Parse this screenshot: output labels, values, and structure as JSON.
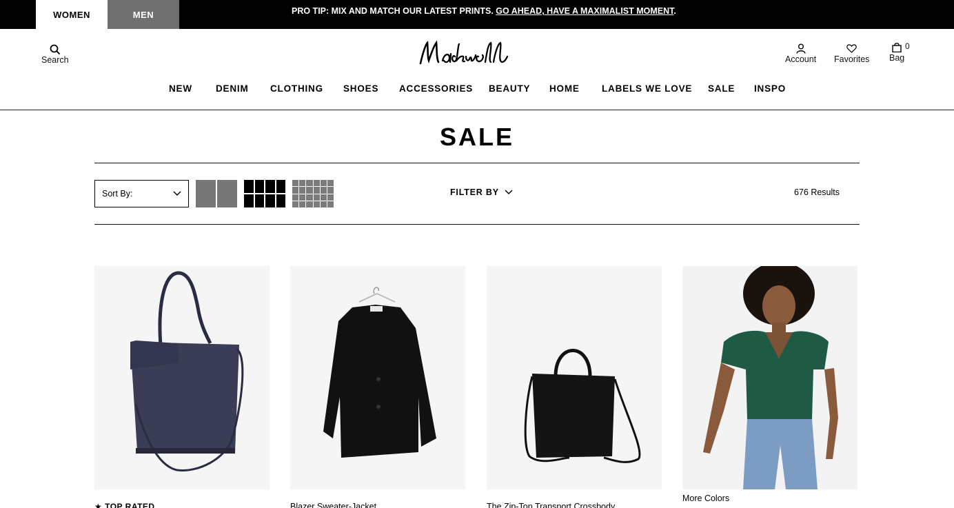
{
  "topbar": {
    "tabs": [
      {
        "label": "WOMEN",
        "active": true
      },
      {
        "label": "MEN",
        "active": false
      }
    ],
    "promo_text": "PRO TIP: MIX AND MATCH OUR LATEST PRINTS. ",
    "promo_link": "GO AHEAD, HAVE A MAXIMALIST MOMENT",
    "promo_end": "."
  },
  "header": {
    "logo": "Madewell",
    "search_label": "Search",
    "account_label": "Account",
    "favorites_label": "Favorites",
    "bag_label": "Bag",
    "bag_count": "0"
  },
  "nav": {
    "items": [
      "NEW",
      "DENIM",
      "CLOTHING",
      "SHOES",
      "ACCESSORIES",
      "BEAUTY",
      "HOME",
      "LABELS WE LOVE",
      "SALE",
      "INSPO"
    ]
  },
  "page": {
    "title": "SALE",
    "sort_label": "Sort By:",
    "filter_label": "FILTER BY",
    "results": "676 Results",
    "grid_view_selected": "4-up"
  },
  "products": [
    {
      "badge": "★ TOP RATED",
      "name": "",
      "image": "tote bag"
    },
    {
      "badge": "",
      "name": "Blazer Sweater-Jacket",
      "image": "black blazer on hanger"
    },
    {
      "badge": "",
      "name": "The Zip-Top Transport Crossbody",
      "image": "black crossbody tote"
    },
    {
      "badge": "",
      "name": "",
      "more_colors": "More Colors",
      "image": "model in green tee and jeans"
    }
  ],
  "colors": {
    "accent": "#000000",
    "men_tab": "#6f6f6f",
    "card_bg": "#f5f5f5",
    "tee_green": "#1f5a45"
  }
}
